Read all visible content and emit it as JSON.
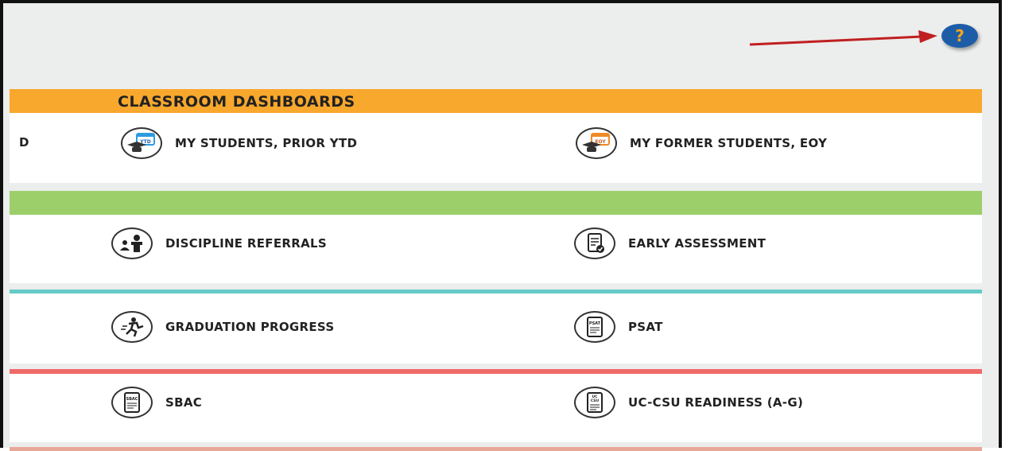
{
  "header": {
    "help_label": "?"
  },
  "colors": {
    "orange": "#f8a82d",
    "green": "#9ccf6a",
    "teal": "#66cbc6",
    "red": "#f06a6a",
    "help_bg": "#1d5da8",
    "arrow": "#c01f22"
  },
  "sections": [
    {
      "title": "CLASSROOM DASHBOARDS",
      "truncated_text": "D",
      "items": [
        {
          "label": "MY STUDENTS, PRIOR YTD",
          "icon": "student-ytd-icon",
          "badge": "YTD"
        },
        {
          "label": "MY FORMER STUDENTS, EOY",
          "icon": "student-eoy-icon",
          "badge": "EOY"
        }
      ]
    },
    {
      "title": "",
      "items": [
        {
          "label": "DISCIPLINE REFERRALS",
          "icon": "discipline-icon"
        },
        {
          "label": "EARLY ASSESSMENT",
          "icon": "checklist-icon"
        }
      ]
    },
    {
      "title": "",
      "items": [
        {
          "label": "GRADUATION PROGRESS",
          "icon": "running-graduate-icon"
        },
        {
          "label": "PSAT",
          "icon": "psat-document-icon",
          "badge": "PSAT"
        }
      ]
    },
    {
      "title": "",
      "items": [
        {
          "label": "SBAC",
          "icon": "sbac-document-icon",
          "badge": "SBAC"
        },
        {
          "label": "UC-CSU READINESS (A-G)",
          "icon": "uc-csu-document-icon",
          "badge": "UC CSU"
        }
      ]
    }
  ]
}
